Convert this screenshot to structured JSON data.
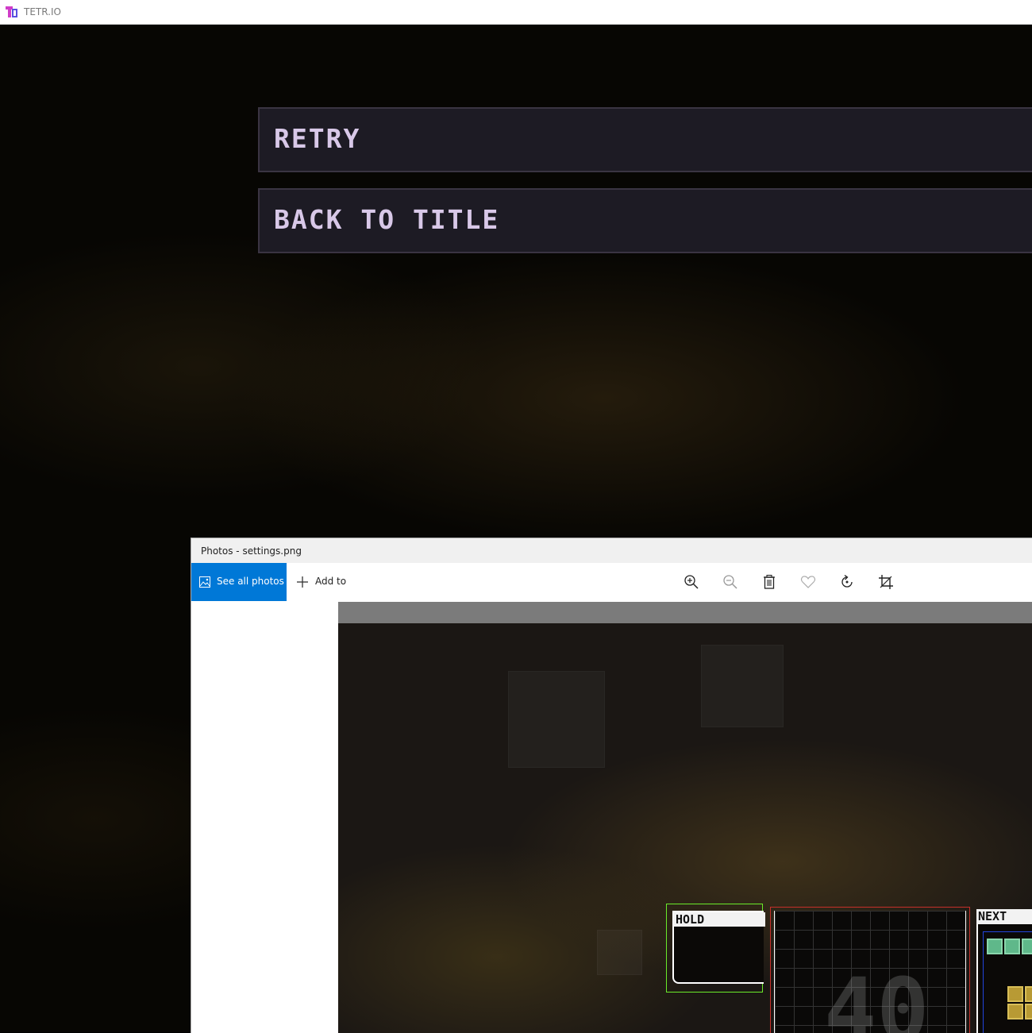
{
  "app": {
    "title": "TETR.IO"
  },
  "game": {
    "retry_label": "RETRY",
    "back_label": "BACK TO TITLE"
  },
  "photos": {
    "title": "Photos - settings.png",
    "see_all_label": "See all photos",
    "add_to_label": "Add to",
    "tools": [
      "zoom-in",
      "zoom-out",
      "delete",
      "favorite",
      "rotate",
      "crop"
    ]
  },
  "image": {
    "hold_label": "HOLD",
    "next_label": "NEXT",
    "counter": "40"
  },
  "colors": {
    "accent": "#0078d7",
    "hold_outline": "#6aeb2a",
    "board_outline": "#c6302a",
    "next_outline": "#2244dd"
  }
}
